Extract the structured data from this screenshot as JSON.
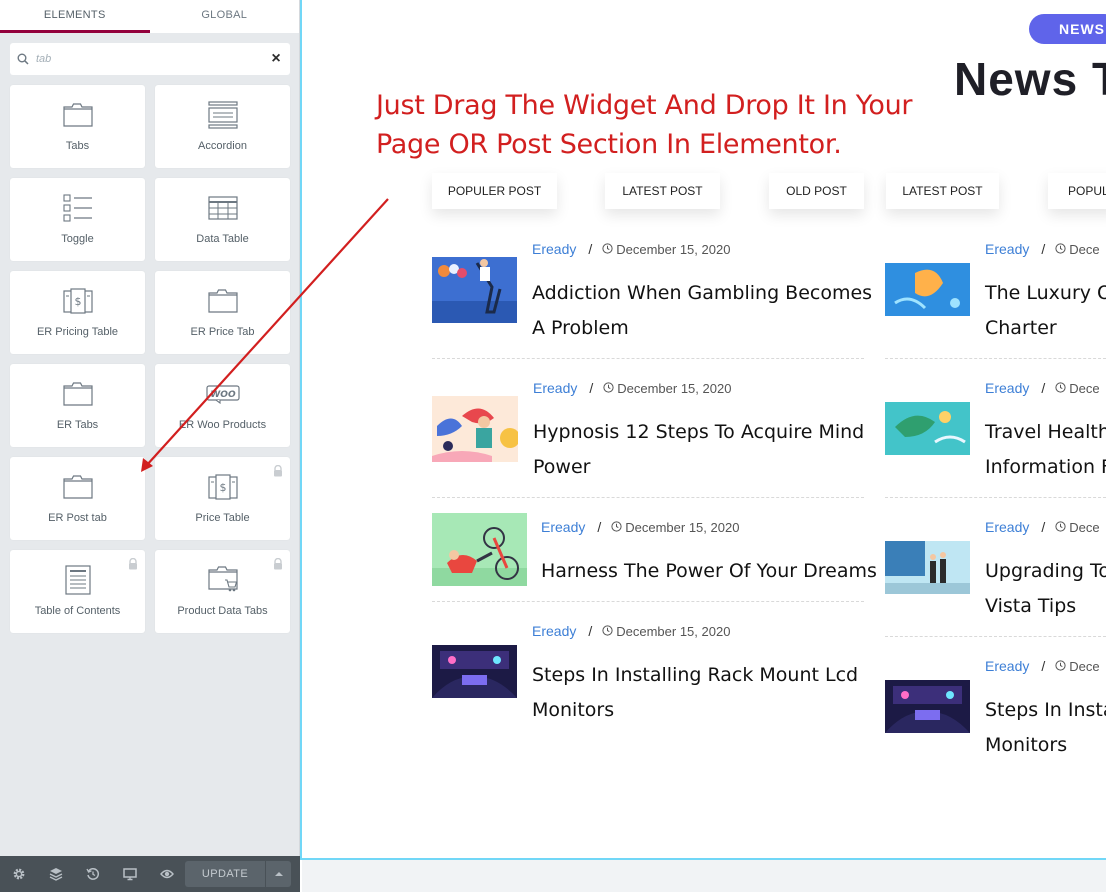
{
  "panel": {
    "tabs": [
      {
        "label": "ELEMENTS"
      },
      {
        "label": "GLOBAL"
      }
    ],
    "search": {
      "value": "tab",
      "icon": "search-icon",
      "clear": "×"
    },
    "widgets": [
      {
        "label": "Tabs",
        "icon": "tabs-icon",
        "locked": false
      },
      {
        "label": "Accordion",
        "icon": "accordion-icon",
        "locked": false
      },
      {
        "label": "Toggle",
        "icon": "toggle-icon",
        "locked": false
      },
      {
        "label": "Data Table",
        "icon": "data-table-icon",
        "locked": false
      },
      {
        "label": "ER Pricing Table",
        "icon": "pricing-table-icon",
        "locked": false
      },
      {
        "label": "ER Price Tab",
        "icon": "tabs-icon",
        "locked": false
      },
      {
        "label": "ER Tabs",
        "icon": "tabs-icon",
        "locked": false
      },
      {
        "label": "ER Woo Products",
        "icon": "woo-icon",
        "locked": false
      },
      {
        "label": "ER Post tab",
        "icon": "tabs-icon",
        "locked": false
      },
      {
        "label": "Price Table",
        "icon": "pricing-table-icon",
        "locked": true
      },
      {
        "label": "Table of Contents",
        "icon": "table-of-contents-icon",
        "locked": true
      },
      {
        "label": "Product Data Tabs",
        "icon": "product-tabs-icon",
        "locked": true
      }
    ],
    "woo_text": "WOO",
    "footer": {
      "update_label": "UPDATE"
    }
  },
  "preview": {
    "badge": "NEWS",
    "title": "News T",
    "annotation_line1": "Just Drag The Widget And Drop It In Your",
    "annotation_line2": "Page OR Post Section In Elementor.",
    "tabs": [
      "POPULER POST",
      "LATEST POST",
      "OLD POST",
      "LATEST POST",
      "POPUL"
    ],
    "left_posts": [
      {
        "category": "Eready",
        "date": "December 15, 2020",
        "title_line1": "Addiction When Gambling Becomes",
        "title_line2": "A Problem"
      },
      {
        "category": "Eready",
        "date": "December 15, 2020",
        "title_line1": "Hypnosis 12 Steps To Acquire Mind",
        "title_line2": "Power"
      },
      {
        "category": "Eready",
        "date": "December 15, 2020",
        "title_line1": "Harness The Power Of Your Dreams",
        "title_line2": ""
      },
      {
        "category": "Eready",
        "date": "December 15, 2020",
        "title_line1": "Steps In Installing Rack Mount Lcd",
        "title_line2": "Monitors"
      }
    ],
    "right_posts": [
      {
        "category": "Eready",
        "date": "Dece",
        "title_line1": "The Luxury Of",
        "title_line2": "Charter"
      },
      {
        "category": "Eready",
        "date": "Dece",
        "title_line1": "Travel Health",
        "title_line2": "Information F"
      },
      {
        "category": "Eready",
        "date": "Dece",
        "title_line1": "Upgrading To",
        "title_line2": "Vista Tips"
      },
      {
        "category": "Eready",
        "date": "Dece",
        "title_line1": "Steps In Insta",
        "title_line2": "Monitors"
      }
    ]
  },
  "colors": {
    "accent": "#93003c",
    "badge": "#5f64ea",
    "category": "#3d7fd6",
    "annotation": "#d21f1f",
    "preview_border": "#71d7f7"
  }
}
